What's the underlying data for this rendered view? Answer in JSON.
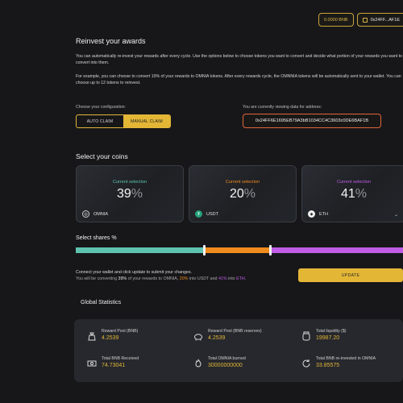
{
  "header": {
    "balance": "0.0000 BNB",
    "address_short": "0x24FF...AF1E"
  },
  "reinvest": {
    "title": "Reinvest your awards",
    "intro": "You can automatically re-invest your rewards after every cycle. Use the options below to choose tokens you want to convert and decide what portion of your rewards you want to convert into them.",
    "example": "For example, you can choose to convert 10% of your rewards to OMNIA tokens. After every rewards cycle, the OMNNIA tokens will be automatically sent to your wallet. You can choose up to 12 tokens to reinvest."
  },
  "config": {
    "label": "Choose your configuration:",
    "auto_label": "AUTO CLAIM",
    "manual_label": "MANUAL CLAIM"
  },
  "viewing": {
    "label": "You are currently viewing data for address:",
    "address": "0x24FF6E1695EB79A3bB1034CC4C3603c0DE6BAF1B"
  },
  "coins": {
    "title": "Select your coins",
    "selection_label": "Current selection",
    "items": [
      {
        "value": "39",
        "token": "OMNIA",
        "color": "#5ec4b0"
      },
      {
        "value": "20",
        "token": "USDT",
        "color": "#f08b1d"
      },
      {
        "value": "41",
        "token": "ETH",
        "color": "#c05ce6"
      }
    ]
  },
  "shares": {
    "title": "Select shares %",
    "values": [
      39,
      20,
      41
    ]
  },
  "submit": {
    "line1": "Connect your wallet and click update to submit your changes.",
    "line2_prefix": "You will be converting ",
    "pct1": "39%",
    "mid1": " of your rewards to OMNIA, ",
    "pct2": "20%",
    "mid2": " into USDT and ",
    "pct3": "41%",
    "mid3": " into ",
    "tok3": "ETH",
    "end": ".",
    "update_label": "UPDATE"
  },
  "stats": {
    "title": "Global Statistics",
    "items": [
      {
        "label": "Reward Pool (BNB)",
        "value": "4.2539",
        "icon": "money-bag-icon"
      },
      {
        "label": "Reward Pool (BNB reserves)",
        "value": "4.2539",
        "icon": "piggy-bank-icon"
      },
      {
        "label": "Total liquidity ($)",
        "value": "19987.20",
        "icon": "jar-icon"
      },
      {
        "label": "Total BNB Received",
        "value": "74.73041",
        "icon": "money-stack-icon"
      },
      {
        "label": "Total OMNIA burned",
        "value": "30000000000",
        "icon": "fire-icon"
      },
      {
        "label": "Total BNB re-invested in OMNIA",
        "value": "33.85575",
        "icon": "refresh-icon"
      }
    ]
  },
  "colors": {
    "accent": "#e3b636",
    "omnia": "#5ec4b0",
    "usdt": "#f08b1d",
    "eth": "#c05ce6"
  }
}
